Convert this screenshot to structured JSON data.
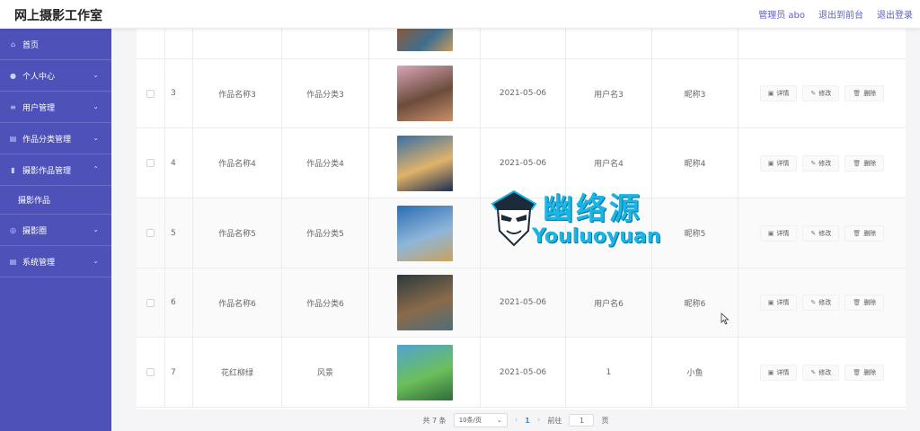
{
  "header": {
    "app_title": "网上摄影工作室",
    "links": [
      "管理员 abo",
      "退出到前台",
      "退出登录"
    ]
  },
  "sidebar": {
    "items": [
      {
        "label": "首页",
        "icon": "home-icon",
        "expandable": false
      },
      {
        "label": "个人中心",
        "icon": "user-icon",
        "expandable": true
      },
      {
        "label": "用户管理",
        "icon": "list-icon",
        "expandable": true
      },
      {
        "label": "作品分类管理",
        "icon": "category-icon",
        "expandable": true
      },
      {
        "label": "摄影作品管理",
        "icon": "bar-chart-icon",
        "expandable": true,
        "expanded": true,
        "children": [
          "摄影作品"
        ]
      },
      {
        "label": "摄影圈",
        "icon": "circle-icon",
        "expandable": true
      },
      {
        "label": "系统管理",
        "icon": "settings-icon",
        "expandable": true
      }
    ]
  },
  "table": {
    "actions": {
      "detail": "详情",
      "edit": "修改",
      "delete": "删除"
    },
    "rows": [
      {
        "index": "3",
        "name": "作品名称3",
        "category": "作品分类3",
        "date": "2021-05-06",
        "username": "用户名3",
        "nickname": "昵称3",
        "thumb_colors": [
          "#d9a5b9",
          "#6b4c3a",
          "#c98f6a"
        ]
      },
      {
        "index": "4",
        "name": "作品名称4",
        "category": "作品分类4",
        "date": "2021-05-06",
        "username": "用户名4",
        "nickname": "昵称4",
        "thumb_colors": [
          "#3a6ea5",
          "#e0b36a",
          "#1d2d50"
        ]
      },
      {
        "index": "5",
        "name": "作品名称5",
        "category": "作品分类5",
        "date": "",
        "username": "",
        "nickname": "昵称5",
        "thumb_colors": [
          "#2b6db3",
          "#8fb6d9",
          "#c9a25c"
        ]
      },
      {
        "index": "6",
        "name": "作品名称6",
        "category": "作品分类6",
        "date": "2021-05-06",
        "username": "用户名6",
        "nickname": "昵称6",
        "thumb_colors": [
          "#2a3a3c",
          "#8a6a4a",
          "#4d6e7a"
        ]
      },
      {
        "index": "7",
        "name": "花红柳绿",
        "category": "风景",
        "date": "2021-05-06",
        "username": "1",
        "nickname": "小鱼",
        "thumb_colors": [
          "#4fa3d1",
          "#6cbf5a",
          "#2f6b3b"
        ]
      }
    ]
  },
  "pagination": {
    "total": "共 7 条",
    "page_size": "10条/页",
    "current_page": "1",
    "goto_label": "前往",
    "goto_value": "1",
    "page_unit": "页"
  },
  "watermark": {
    "cn": "幽络源",
    "en": "Youluoyuan"
  },
  "colors": {
    "sidebar_bg": "#4e52b8",
    "accent": "#5b5fc7",
    "watermark": "#17b6e6"
  }
}
